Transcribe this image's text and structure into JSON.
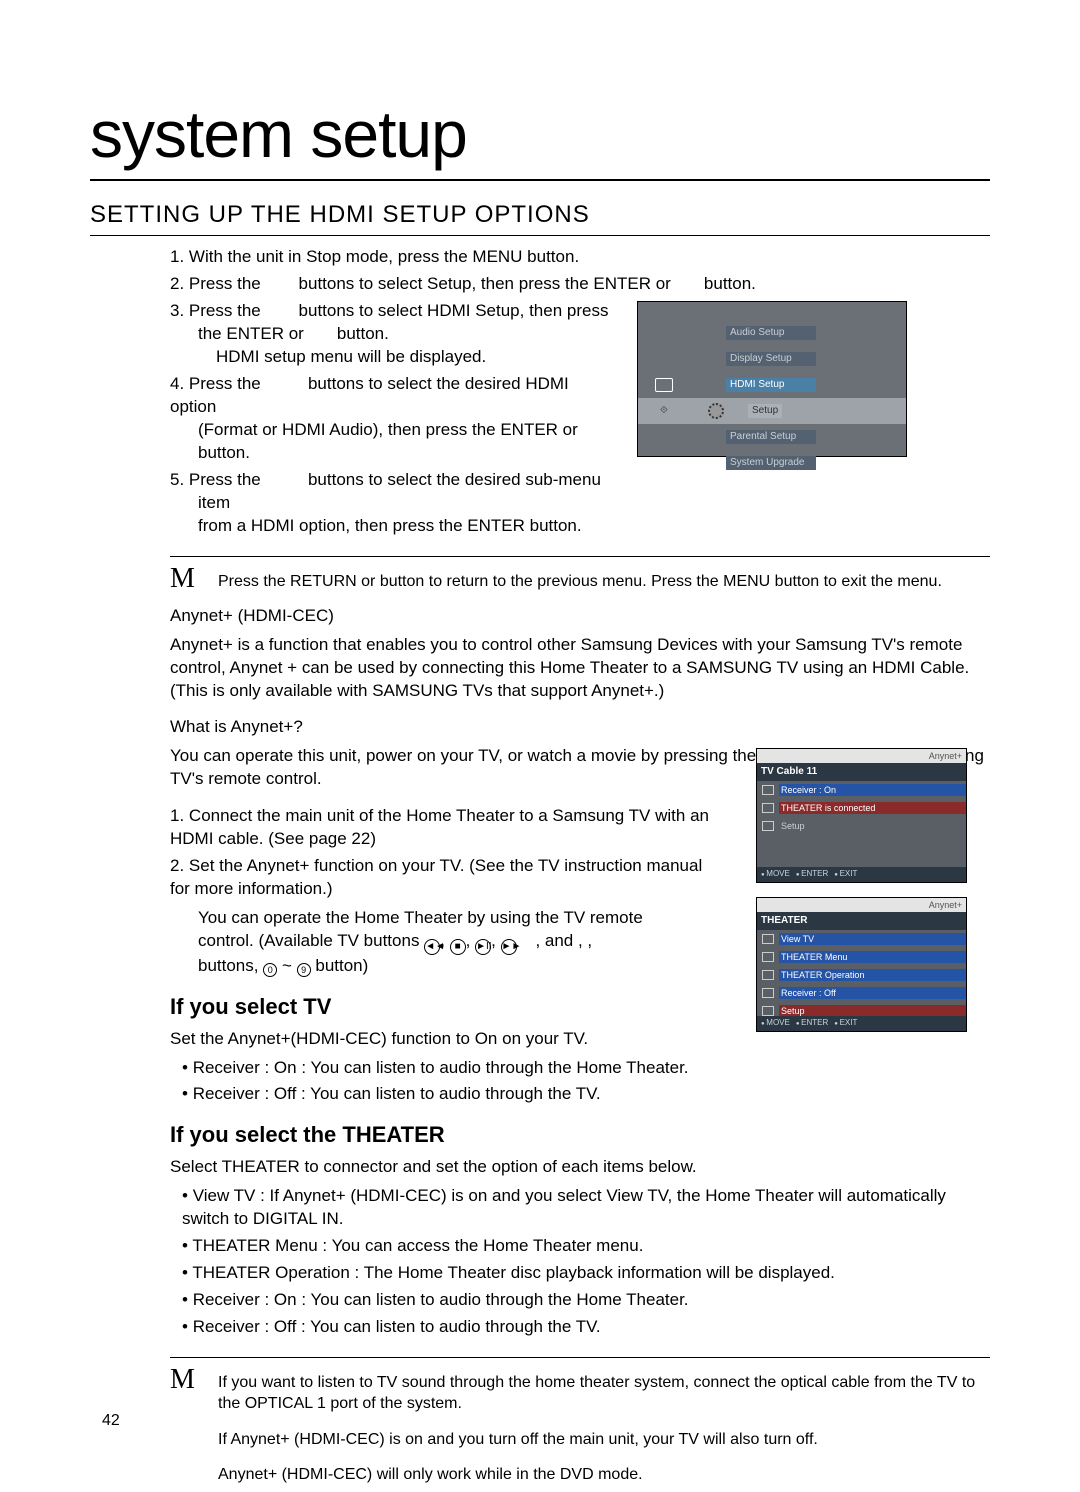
{
  "title": "system setup",
  "section_heading": "SETTING UP THE HDMI SETUP OPTIONS",
  "steps": {
    "s1": "With the unit in Stop mode, press the MENU button.",
    "s2a": "Press the",
    "s2b": "buttons to select Setup, then press the ENTER or",
    "s2c": "button.",
    "s3a": "Press the",
    "s3b": "buttons to select HDMI Setup, then press",
    "s3c": "the ENTER or",
    "s3d": "button.",
    "s3e": "HDMI setup menu will be displayed.",
    "s4a": "Press the",
    "s4b": "buttons to select the desired HDMI option",
    "s4c": "(Format or HDMI Audio), then press the ENTER or",
    "s4d": "button.",
    "s5a": "Press the",
    "s5b": "buttons to select the desired sub-menu",
    "s5c": "item",
    "s5d": "from a HDMI option, then press the ENTER button."
  },
  "note1": "Press the RETURN or    button to return to the previous menu. Press the MENU button to exit the menu.",
  "anynet": {
    "heading": "Anynet+ (HDMI-CEC)",
    "desc": "Anynet+ is a function that enables you to control other Samsung Devices with your Samsung TV's remote control, Anynet + can be used by connecting this Home Theater to a SAMSUNG TV using an HDMI Cable. (This is only available with SAMSUNG TVs that support Anynet+.)",
    "what_q": "What is Anynet+?",
    "what_a": "You can operate this unit, power on your TV, or watch a movie by pressing the Play button on your Samsung TV's remote control.",
    "step1": "Connect the main unit of the Home Theater to a Samsung TV with an HDMI cable. (See page 22)",
    "step2a": "Set the Anynet+ function on your TV. (See the TV instruction manual for more information.)",
    "step2b_1": "You can operate the Home Theater by using the TV remote",
    "step2b_2a": "control. (Available TV buttons",
    "step2b_2b": ",    and ,  ,",
    "step2b_3a": "buttons,",
    "step2b_3b": "~",
    "step2b_3c": "button)"
  },
  "select_tv": {
    "heading": "If you select TV",
    "l1": "Set the Anynet+(HDMI-CEC) function to On on your TV.",
    "b1": "Receiver : On : You can listen to audio through the Home Theater.",
    "b2": "Receiver : Off : You can listen to audio through the TV."
  },
  "select_theater": {
    "heading": "If you select the THEATER",
    "l1": "Select THEATER to connector  and set the option of each items below.",
    "b1": "View TV : If Anynet+ (HDMI-CEC) is on and you select View TV, the Home Theater will automatically switch to DIGITAL IN.",
    "b2": "THEATER Menu : You can access the Home Theater menu.",
    "b3": "THEATER Operation : The Home Theater disc playback information will be displayed.",
    "b4": "Receiver : On : You can listen to audio through the Home Theater.",
    "b5": "Receiver : Off : You can listen to audio through the TV."
  },
  "final_notes": {
    "n1": "If you want to listen to TV sound through the home theater system, connect the optical cable from the TV to the OPTICAL 1 port of the system.",
    "n2": "If Anynet+ (HDMI-CEC) is on and you turn off the main unit, your TV will also turn off.",
    "n3": "Anynet+ (HDMI-CEC) will only work while in the DVD mode."
  },
  "page_number": "42",
  "osd1": {
    "setup_label": "Setup",
    "audio_setup": "Audio Setup",
    "display_setup": "Display Setup",
    "hdmi_setup": "HDMI Setup",
    "parental_setup": "Parental Setup",
    "system_upgrade": "System Upgrade"
  },
  "osd2": {
    "brand": "Anynet+",
    "title": "TV Cable 11",
    "r1": "Receiver :   On",
    "r2": "THEATER is connected",
    "r3": "Setup",
    "move": "MOVE",
    "enter": "ENTER",
    "exit": "EXIT"
  },
  "osd3": {
    "brand": "Anynet+",
    "title": "THEATER",
    "r1": "View TV",
    "r2": "THEATER Menu",
    "r3": "THEATER Operation",
    "r4": "Receiver :   Off",
    "r5": "Setup",
    "move": "MOVE",
    "enter": "ENTER",
    "exit": "EXIT"
  }
}
